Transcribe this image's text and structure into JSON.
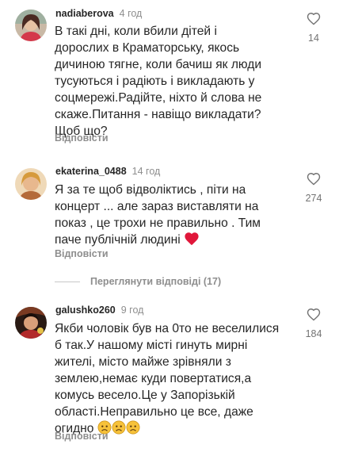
{
  "colors": {
    "text": "#262626",
    "muted": "#8e8e8e",
    "heart_red": "#ed4956",
    "rule": "#c7c7c7"
  },
  "comments": [
    {
      "username": "nadiaberova",
      "time": "4 год",
      "lines": [
        "В такі дні, коли вбили дітей і",
        "дорослих в Краматорську, якось",
        "дичиною тягне, коли бачиш як люди",
        "тусуються і радіють і викладають у",
        "соцмережі.Радійте, ніхто й слова не",
        "скаже.Питання - навіщо викладати?",
        "Щоб що?"
      ],
      "reply_label": "Відповісти",
      "likes": "14",
      "avatar_icon": "avatar-photo"
    },
    {
      "username": "ekaterina_0488",
      "time": "14 год",
      "lines": [
        "Я за те щоб відволіктись , піти на",
        "концерт ... але зараз виставляти на",
        "показ , це трохи не правильно . Тим",
        "паче публічній людині"
      ],
      "trailing_emoji": "red-heart-emoji",
      "reply_label": "Відповісти",
      "likes": "274",
      "avatar_icon": "avatar-photo"
    },
    {
      "username": "galushko260",
      "time": "9 год",
      "lines": [
        "Якби чоловік був на 0то не веселилися",
        "б так.У нашому місті гинуть мирні",
        "жителі, місто майже зрівняли з",
        "землею,немає куди повертатися,а",
        "комусь весело.Це у Запорізькій",
        "області.Неправильно це все, даже",
        "огидно"
      ],
      "trailing_emoji": "sad-face-emoji x3",
      "reply_label": "Відповісти",
      "likes": "184",
      "avatar_icon": "avatar-photo"
    }
  ],
  "view_replies": "Переглянути відповіді (17)"
}
